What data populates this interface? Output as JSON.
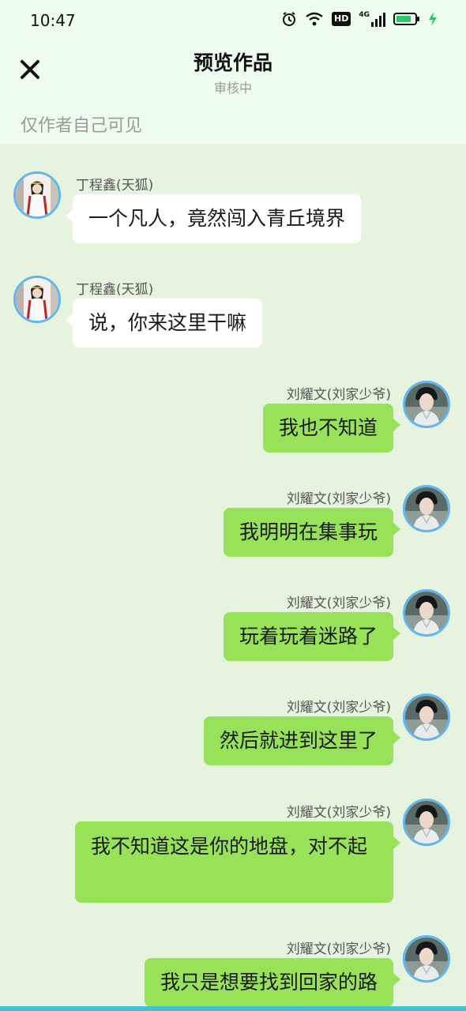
{
  "status_bar": {
    "time": "10:47",
    "icons": [
      "alarm-icon",
      "wifi-icon",
      "hd-icon",
      "signal-4g-icon",
      "battery-icon",
      "charging-icon"
    ],
    "hd_label": "HD",
    "network_label": "4G"
  },
  "header": {
    "title": "预览作品",
    "subtitle": "审核中",
    "close_icon": "close-icon"
  },
  "visibility_note": "仅作者自己可见",
  "messages": [
    {
      "side": "left",
      "name": "丁程鑫(天狐)",
      "text": "一个凡人，竟然闯入青丘境界"
    },
    {
      "side": "left",
      "name": "丁程鑫(天狐)",
      "text": "说，你来这里干嘛"
    },
    {
      "side": "right",
      "name": "刘耀文(刘家少爷)",
      "text": "我也不知道"
    },
    {
      "side": "right",
      "name": "刘耀文(刘家少爷)",
      "text": "我明明在集事玩"
    },
    {
      "side": "right",
      "name": "刘耀文(刘家少爷)",
      "text": "玩着玩着迷路了"
    },
    {
      "side": "right",
      "name": "刘耀文(刘家少爷)",
      "text": "然后就进到这里了"
    },
    {
      "side": "right",
      "name": "刘耀文(刘家少爷)",
      "text": "我不知道这是你的地盘，对不起"
    },
    {
      "side": "right",
      "name": "刘耀文(刘家少爷)",
      "text": "我只是想要找到回家的路"
    }
  ],
  "colors": {
    "chat_background": "#e6f4df",
    "header_background": "#eefced",
    "left_bubble": "#ffffff",
    "right_bubble": "#98e25a",
    "avatar_border": "#63b6ec"
  }
}
